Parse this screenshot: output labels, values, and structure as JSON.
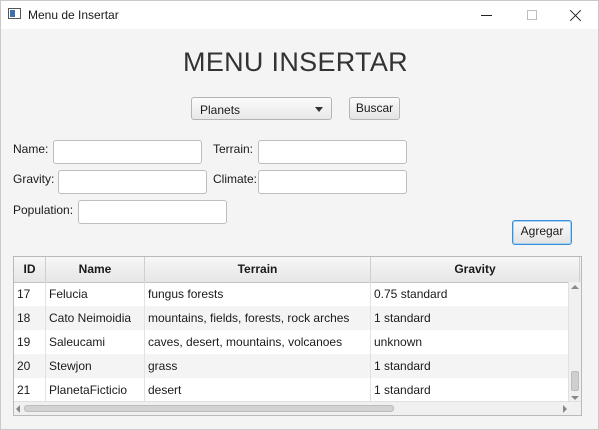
{
  "window": {
    "title": "Menu de Insertar",
    "icon": "app-window-icon",
    "controls": [
      "minimize-icon",
      "maximize-icon",
      "close-icon"
    ]
  },
  "heading": "MENU INSERTAR",
  "selector": {
    "selected": "Planets",
    "search_button": "Buscar"
  },
  "form": {
    "name_label": "Name:",
    "name_value": "",
    "terrain_label": "Terrain:",
    "terrain_value": "",
    "gravity_label": "Gravity:",
    "gravity_value": "",
    "climate_label": "Climate:",
    "climate_value": "",
    "population_label": "Population:",
    "population_value": "",
    "add_button": "Agregar"
  },
  "table": {
    "columns": [
      "ID",
      "Name",
      "Terrain",
      "Gravity"
    ],
    "rows": [
      [
        "17",
        "Felucia",
        "fungus forests",
        "0.75 standard"
      ],
      [
        "18",
        "Cato Neimoidia",
        "mountains, fields, forests, rock arches",
        "1 standard"
      ],
      [
        "19",
        "Saleucami",
        "caves, desert, mountains, volcanoes",
        "unknown"
      ],
      [
        "20",
        "Stewjon",
        "grass",
        "1 standard"
      ],
      [
        "21",
        "PlanetaFicticio",
        "desert",
        "1 standard"
      ]
    ]
  },
  "colors": {
    "focus_border": "#3b8ed8",
    "window_bg": "#f4f4f4"
  }
}
